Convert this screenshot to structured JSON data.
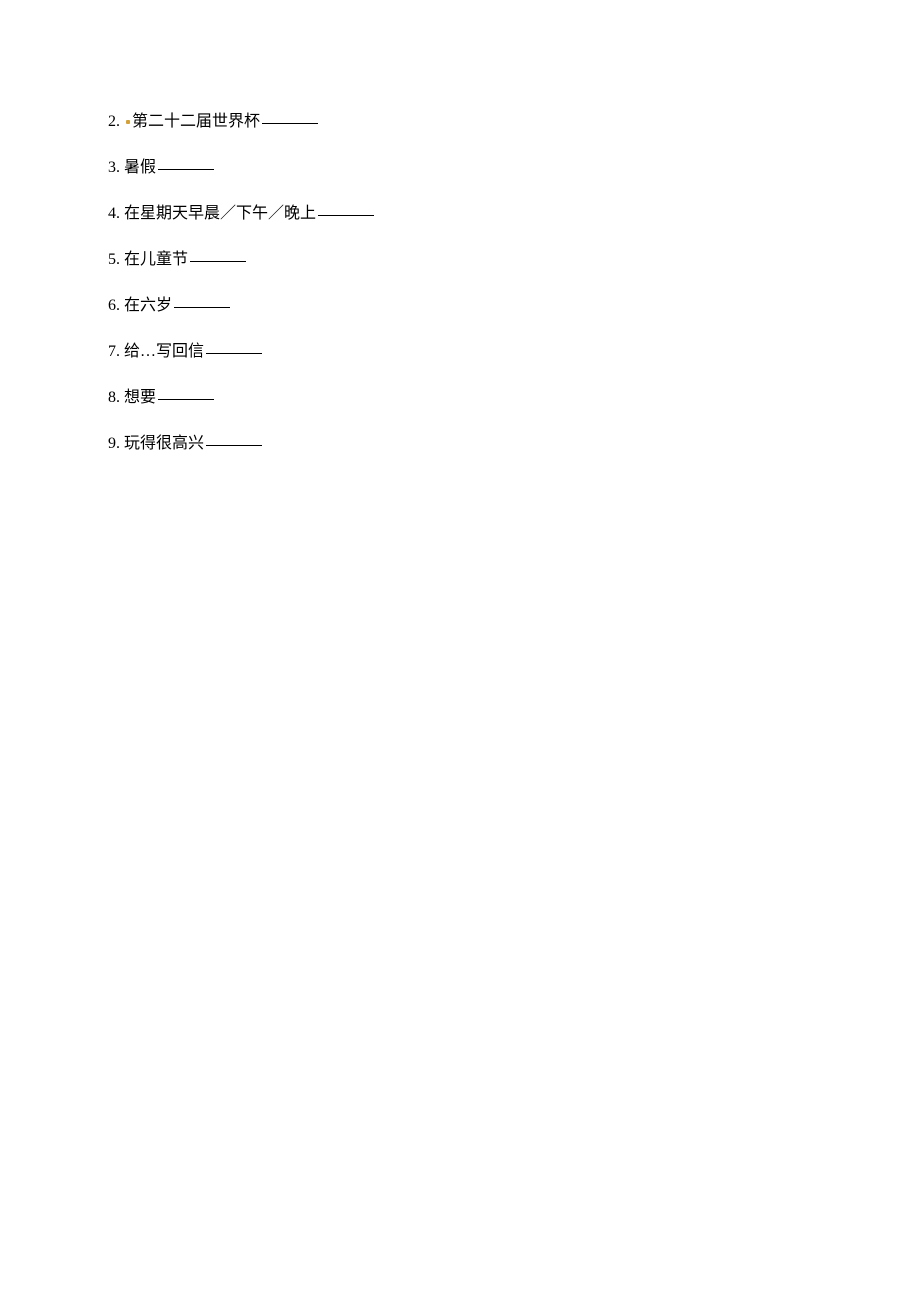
{
  "items": [
    {
      "num": "2.",
      "hasMark": true,
      "text": "第二十二届世界杯"
    },
    {
      "num": "3.",
      "hasMark": false,
      "text": "暑假"
    },
    {
      "num": "4.",
      "hasMark": false,
      "text": "在星期天早晨／下午／晚上"
    },
    {
      "num": "5.",
      "hasMark": false,
      "text": "在儿童节"
    },
    {
      "num": "6.",
      "hasMark": false,
      "text": "在六岁"
    },
    {
      "num": "7.",
      "hasMark": false,
      "text": "给…写回信"
    },
    {
      "num": "8.",
      "hasMark": false,
      "text": "想要"
    },
    {
      "num": "9.",
      "hasMark": false,
      "text": "玩得很高兴"
    }
  ]
}
